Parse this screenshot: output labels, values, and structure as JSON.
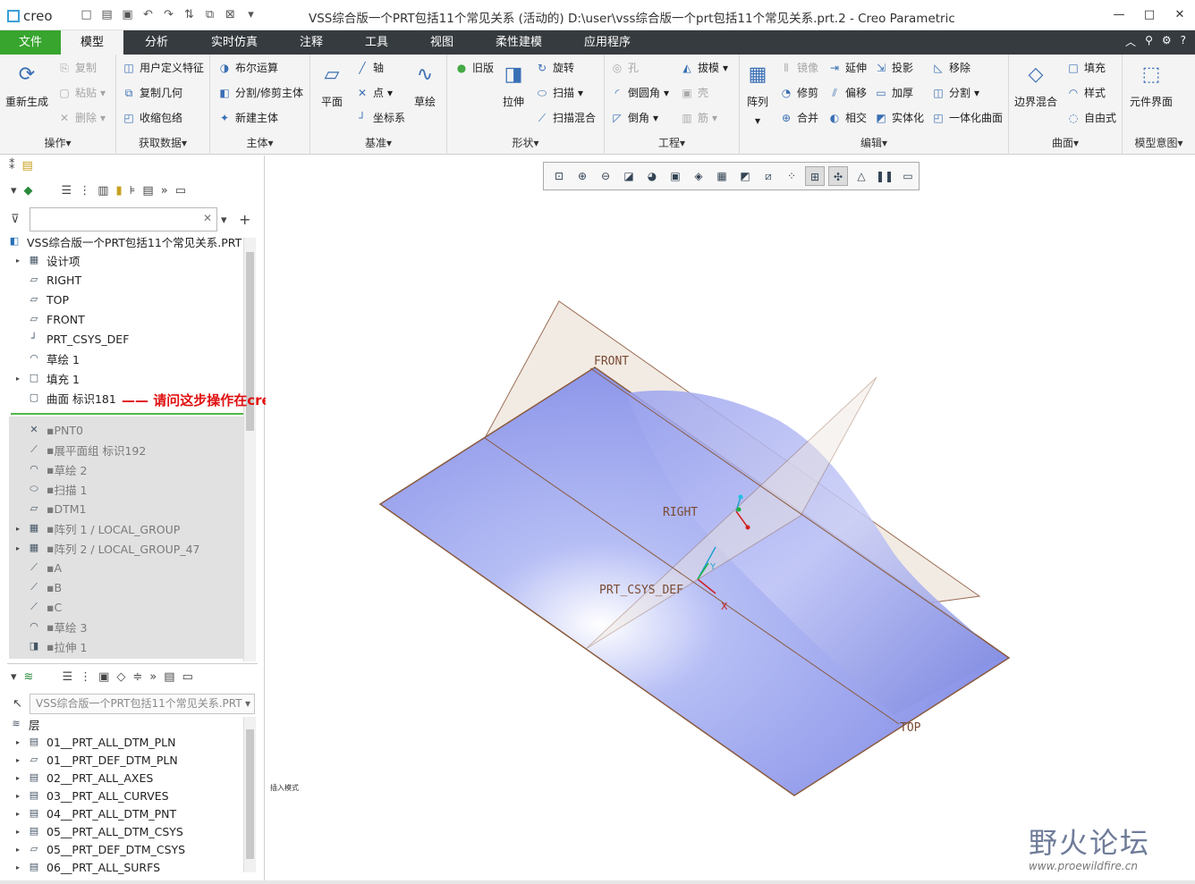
{
  "app": {
    "logo": "creo",
    "window_title": "VSS综合版一个PRT包括11个常见关系 (活动的) D:\\user\\vss综合版一个prt包括11个常见关系.prt.2 - Creo Parametric"
  },
  "tabs": [
    {
      "label": "文件"
    },
    {
      "label": "模型"
    },
    {
      "label": "分析"
    },
    {
      "label": "实时仿真"
    },
    {
      "label": "注释"
    },
    {
      "label": "工具"
    },
    {
      "label": "视图"
    },
    {
      "label": "柔性建模"
    },
    {
      "label": "应用程序"
    }
  ],
  "ribbon": {
    "ops": {
      "regen": "重新生成",
      "copy": "复制",
      "paste": "粘贴",
      "delete": "删除",
      "label": "操作"
    },
    "getdata": {
      "udf": "用户定义特征",
      "copygeom": "复制几何",
      "shrink": "收缩包络",
      "label": "获取数据"
    },
    "body": {
      "bool": "布尔运算",
      "split": "分割/修剪主体",
      "newbody": "新建主体",
      "label": "主体"
    },
    "datum": {
      "plane": "平面",
      "axis": "轴",
      "point": "点",
      "csys": "坐标系",
      "sketch": "草绘",
      "label": "基准"
    },
    "shape": {
      "legacy": "旧版",
      "extrude": "拉伸",
      "revolve": "旋转",
      "sweep": "扫描",
      "swblend": "扫描混合",
      "label": "形状"
    },
    "eng": {
      "hole": "孔",
      "round": "倒圆角",
      "chamfer": "倒角",
      "draft": "拔模",
      "shell": "壳",
      "rib": "筋",
      "label": "工程"
    },
    "edit": {
      "pattern": "阵列",
      "mirror": "镜像",
      "trim": "修剪",
      "merge": "合并",
      "extend": "延伸",
      "offset": "偏移",
      "intersect": "相交",
      "project": "投影",
      "thicken": "加厚",
      "solidify": "实体化",
      "remove": "移除",
      "split": "分割",
      "unify": "一体化曲面",
      "label": "编辑"
    },
    "surface": {
      "boundary": "边界混合",
      "fill": "填充",
      "style": "样式",
      "freestyle": "自由式",
      "label": "曲面"
    },
    "intent": {
      "component": "元件界面",
      "label": "模型意图"
    }
  },
  "model_tree": {
    "root": "VSS综合版一个PRT包括11个常见关系.PRT",
    "items": [
      {
        "label": "设计项",
        "icon": "design-items-icon"
      },
      {
        "label": "RIGHT",
        "icon": "datum-plane-icon"
      },
      {
        "label": "TOP",
        "icon": "datum-plane-icon"
      },
      {
        "label": "FRONT",
        "icon": "datum-plane-icon"
      },
      {
        "label": "PRT_CSYS_DEF",
        "icon": "csys-icon"
      },
      {
        "label": "草绘 1",
        "icon": "sketch-icon"
      },
      {
        "label": "填充 1",
        "icon": "fill-icon"
      },
      {
        "label": "曲面 标识181",
        "icon": "surface-icon"
      }
    ],
    "suppressed": [
      {
        "label": "PNT0",
        "icon": "point-icon"
      },
      {
        "label": "展平面组 标识192",
        "icon": "flatten-icon"
      },
      {
        "label": "草绘 2",
        "icon": "sketch-icon"
      },
      {
        "label": "扫描 1",
        "icon": "sweep-icon"
      },
      {
        "label": "DTM1",
        "icon": "datum-plane-icon"
      },
      {
        "label": "阵列 1 / LOCAL_GROUP",
        "icon": "pattern-icon"
      },
      {
        "label": "阵列 2 / LOCAL_GROUP_47",
        "icon": "pattern-icon"
      },
      {
        "label": "A",
        "icon": "curve-icon"
      },
      {
        "label": "B",
        "icon": "curve-icon"
      },
      {
        "label": "C",
        "icon": "curve-icon"
      },
      {
        "label": "草绘 3",
        "icon": "sketch-icon"
      },
      {
        "label": "拉伸 1",
        "icon": "extrude-icon"
      }
    ]
  },
  "layer_tree": {
    "model_select": "VSS综合版一个PRT包括11个常见关系.PRT",
    "header": "层",
    "items": [
      {
        "label": "01__PRT_ALL_DTM_PLN"
      },
      {
        "label": "01__PRT_DEF_DTM_PLN"
      },
      {
        "label": "02__PRT_ALL_AXES"
      },
      {
        "label": "03__PRT_ALL_CURVES"
      },
      {
        "label": "04__PRT_ALL_DTM_PNT"
      },
      {
        "label": "05__PRT_ALL_DTM_CSYS"
      },
      {
        "label": "05__PRT_DEF_DTM_CSYS"
      },
      {
        "label": "06__PRT_ALL_SURFS"
      }
    ]
  },
  "annotation": "——  请问这步操作在creo中使用哪个命令",
  "viewport": {
    "front": "FRONT",
    "right": "RIGHT",
    "top": "TOP",
    "csys": "PRT_CSYS_DEF",
    "axis_x": "X",
    "axis_y": "Y",
    "mode": "插入模式"
  },
  "watermark": {
    "title": "野火论坛",
    "url": "www.proewildfire.cn"
  },
  "colors": {
    "file_tab": "#37a52e",
    "tabbar": "#363b3f",
    "surface": "#8d96e8",
    "annotation": "#e01010"
  }
}
